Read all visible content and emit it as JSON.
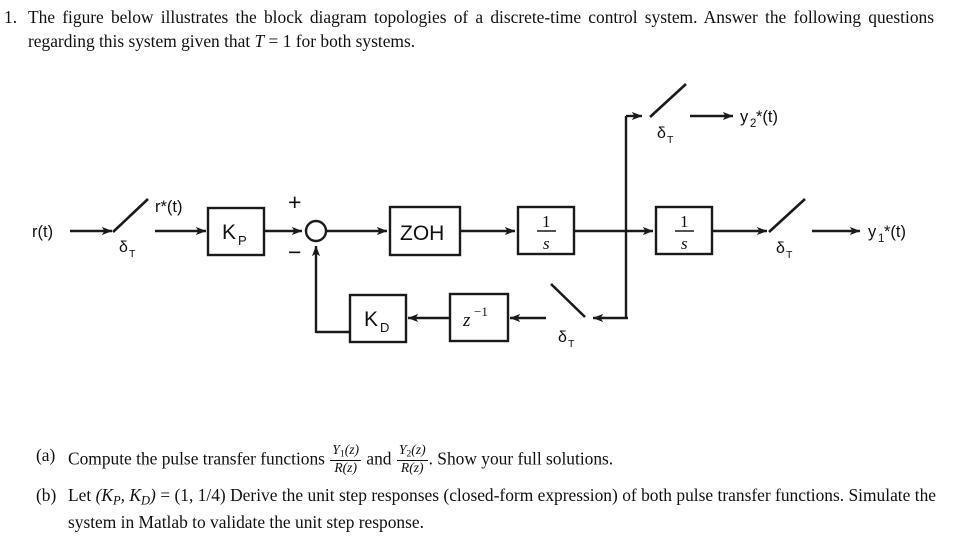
{
  "problem": {
    "number": "1.",
    "text_part1": "The figure below illustrates the block diagram topologies of a discrete-time control system.  Answer the following questions regarding this system given that ",
    "math_T": "T",
    "math_eq": " = 1",
    "text_part2": " for both systems."
  },
  "diagram": {
    "input_label": "r(t)",
    "sampled_input_label": "r*(t)",
    "sampler_label_delta": "δ",
    "sampler_label_sub": "T",
    "blocks": {
      "kp": {
        "base": "K",
        "sub": "P"
      },
      "kd": {
        "base": "K",
        "sub": "D"
      },
      "zoh": {
        "label": "ZOH"
      },
      "integrator1": {
        "numerator": "1",
        "denominator": "s"
      },
      "integrator2": {
        "numerator": "1",
        "denominator": "s"
      },
      "delay": {
        "base": "z",
        "exponent": "−1"
      }
    },
    "summing_junction": {
      "plus_sign": "+",
      "minus_sign": "−"
    },
    "outputs": {
      "y1": {
        "base": "y",
        "sub": "1",
        "suffix": "*(t)"
      },
      "y2": {
        "base": "y",
        "sub": "2",
        "suffix": "*(t)"
      }
    },
    "colors": {
      "line": "#1a1a1a",
      "text": "#101010",
      "background": "#ffffff"
    }
  },
  "questions": [
    {
      "tag": "(a)",
      "text_before": "Compute the pulse transfer functions ",
      "frac1": {
        "num_base": "Y",
        "num_sub": "1",
        "num_arg": "(z)",
        "den": "R(z)"
      },
      "text_middle": " and ",
      "frac2": {
        "num_base": "Y",
        "num_sub": "2",
        "num_arg": "(z)",
        "den": "R(z)"
      },
      "text_after": ". Show your full solutions."
    },
    {
      "tag": "(b)",
      "text_before": "Let ",
      "math_params": "(K",
      "math_sub1": "P",
      "math_comma": ", K",
      "math_sub2": "D",
      "math_close": ")",
      "math_values": " = (1, 1/4)",
      "text_after": " Derive the unit step responses (closed-form expression) of both pulse transfer functions. Simulate the system in Matlab to validate the unit step response."
    }
  ]
}
